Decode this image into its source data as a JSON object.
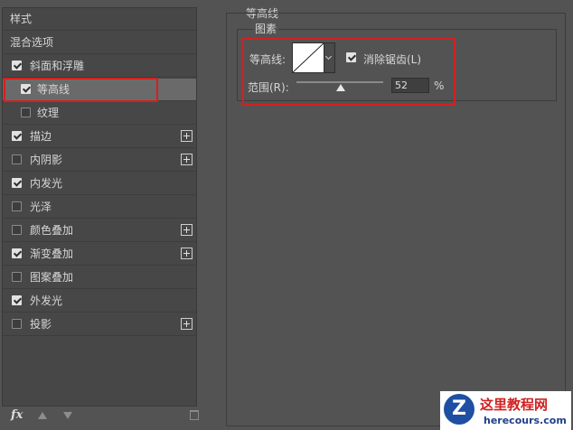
{
  "sidebar": {
    "header": "样式",
    "items": [
      {
        "label": "混合选项",
        "has_checkbox": false,
        "checked": false
      },
      {
        "label": "斜面和浮雕",
        "has_checkbox": true,
        "checked": true
      },
      {
        "label": "等高线",
        "has_checkbox": true,
        "checked": true,
        "selected": true,
        "sub": true
      },
      {
        "label": "纹理",
        "has_checkbox": true,
        "checked": false,
        "sub": true
      },
      {
        "label": "描边",
        "has_checkbox": true,
        "checked": true,
        "has_plus": true
      },
      {
        "label": "内阴影",
        "has_checkbox": true,
        "checked": false,
        "has_plus": true
      },
      {
        "label": "内发光",
        "has_checkbox": true,
        "checked": true
      },
      {
        "label": "光泽",
        "has_checkbox": true,
        "checked": false
      },
      {
        "label": "颜色叠加",
        "has_checkbox": true,
        "checked": false,
        "has_plus": true
      },
      {
        "label": "渐变叠加",
        "has_checkbox": true,
        "checked": true,
        "has_plus": true
      },
      {
        "label": "图案叠加",
        "has_checkbox": true,
        "checked": false
      },
      {
        "label": "外发光",
        "has_checkbox": true,
        "checked": true
      },
      {
        "label": "投影",
        "has_checkbox": true,
        "checked": false,
        "has_plus": true
      }
    ],
    "fx_label": "fx"
  },
  "panel": {
    "section_title": "等高线",
    "group_title": "图素",
    "contour_label": "等高线:",
    "anti_alias_label": "消除锯齿(L)",
    "anti_alias_checked": true,
    "range_label": "范围(R):",
    "range_value": "52",
    "range_unit": "%"
  },
  "watermark": {
    "title": "这里教程网",
    "url": "herecours.com",
    "logo_letter": "Z"
  },
  "colors": {
    "background": "#535353",
    "highlight_box": "#d42020"
  }
}
